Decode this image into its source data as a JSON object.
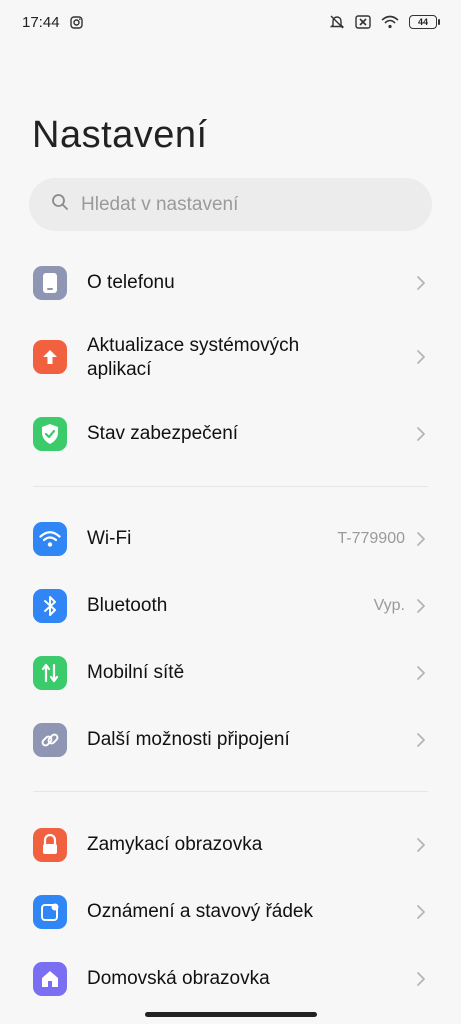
{
  "status_bar": {
    "time": "17:44",
    "battery": "44",
    "icons": [
      "instagram-icon",
      "mute-icon",
      "no-sim-icon",
      "wifi-icon",
      "battery-icon"
    ]
  },
  "header": {
    "title": "Nastavení"
  },
  "search": {
    "placeholder": "Hledat v nastavení"
  },
  "settings": {
    "group1": [
      {
        "label": "O telefonu",
        "icon": "phone-icon",
        "color": "#8e96b3"
      },
      {
        "label": "Aktualizace systémových",
        "label2": "aplikací",
        "icon": "upload-icon",
        "color": "#f2613f"
      },
      {
        "label": "Stav zabezpečení",
        "icon": "shield-check-icon",
        "color": "#3ccb6b"
      }
    ],
    "group2": [
      {
        "label": "Wi-Fi",
        "value": "T-779900",
        "icon": "wifi-icon",
        "color": "#2f86f4"
      },
      {
        "label": "Bluetooth",
        "value": "Vyp.",
        "icon": "bluetooth-icon",
        "color": "#2f86f4"
      },
      {
        "label": "Mobilní sítě",
        "icon": "signal-arrows-icon",
        "color": "#3ccb6b"
      },
      {
        "label": "Další možnosti připojení",
        "icon": "link-icon",
        "color": "#8e96b3"
      }
    ],
    "group3": [
      {
        "label": "Zamykací obrazovka",
        "icon": "lock-icon",
        "color": "#f2613f"
      },
      {
        "label": "Oznámení a stavový řádek",
        "icon": "notification-icon",
        "color": "#2f86f4"
      },
      {
        "label": "Domovská obrazovka",
        "icon": "home-icon",
        "color": "#7a6ef2"
      }
    ]
  }
}
